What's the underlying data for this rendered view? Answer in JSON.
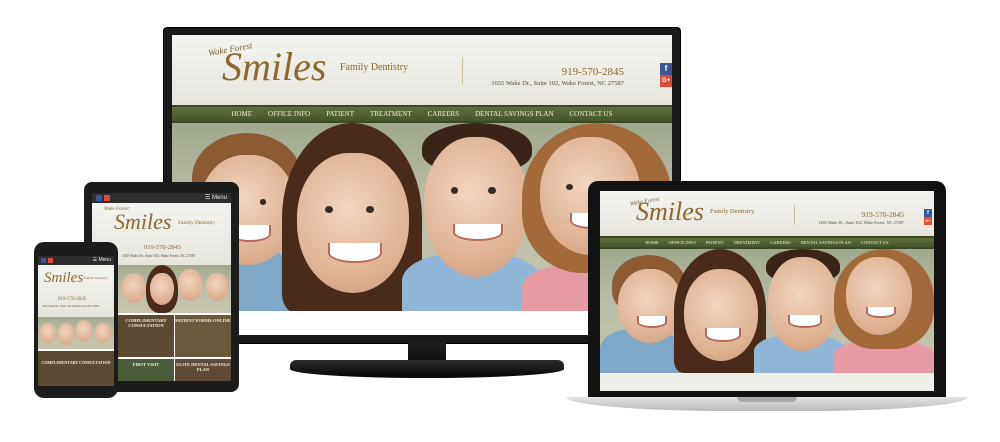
{
  "site": {
    "logo_small": "Wake Forest",
    "logo_main": "Smiles",
    "logo_tagline": "Family Dentistry",
    "phone": "919-570-2845",
    "address": "1655 Wake Dr., Suite 102, Wake Forest, NC 27587",
    "nav": [
      "HOME",
      "OFFICE INFO",
      "PATIENT",
      "TREATMENT",
      "CAREERS",
      "DENTAL SAVINGS PLAN",
      "CONTACT US"
    ],
    "social": [
      "f",
      "G+"
    ],
    "menu_label": "☰ Menu"
  },
  "tablet_tiles": [
    "COMPLIMENTARY CONSULTATION",
    "PATIENT FORMS ONLINE",
    "FIRST VISIT",
    "ELITE DENTAL SAVINGS PLAN"
  ],
  "phone_tiles": [
    "COMPLIMENTARY CONSULTATION"
  ],
  "colors": {
    "nav_green": "#4f5e30",
    "logo_gold": "#8a6a2c",
    "facebook": "#3b5998",
    "google_plus": "#dd4b39"
  }
}
